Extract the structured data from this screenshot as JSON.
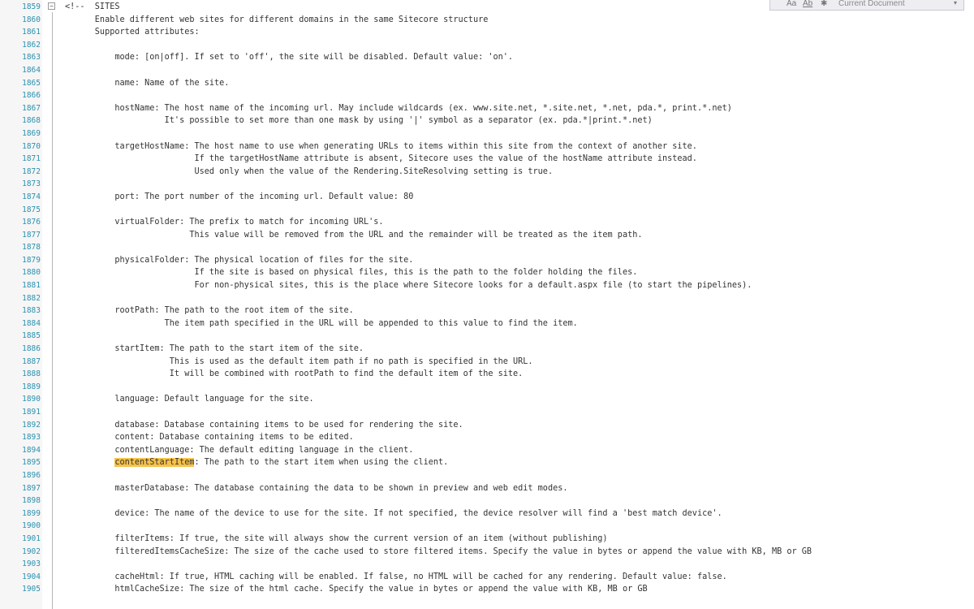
{
  "find": {
    "match_case": "Aa",
    "whole_word": "Ab",
    "regex": "✱",
    "scope": "Current Document",
    "dropdown": "▾"
  },
  "fold_marker": "−",
  "lines": [
    {
      "n": "1859",
      "t": "<!--  SITES"
    },
    {
      "n": "1860",
      "t": "      Enable different web sites for different domains in the same Sitecore structure"
    },
    {
      "n": "1861",
      "t": "      Supported attributes:"
    },
    {
      "n": "1862",
      "t": ""
    },
    {
      "n": "1863",
      "t": "          mode: [on|off]. If set to 'off', the site will be disabled. Default value: 'on'."
    },
    {
      "n": "1864",
      "t": ""
    },
    {
      "n": "1865",
      "t": "          name: Name of the site."
    },
    {
      "n": "1866",
      "t": ""
    },
    {
      "n": "1867",
      "t": "          hostName: The host name of the incoming url. May include wildcards (ex. www.site.net, *.site.net, *.net, pda.*, print.*.net)"
    },
    {
      "n": "1868",
      "t": "                    It's possible to set more than one mask by using '|' symbol as a separator (ex. pda.*|print.*.net)"
    },
    {
      "n": "1869",
      "t": ""
    },
    {
      "n": "1870",
      "t": "          targetHostName: The host name to use when generating URLs to items within this site from the context of another site."
    },
    {
      "n": "1871",
      "t": "                          If the targetHostName attribute is absent, Sitecore uses the value of the hostName attribute instead."
    },
    {
      "n": "1872",
      "t": "                          Used only when the value of the Rendering.SiteResolving setting is true."
    },
    {
      "n": "1873",
      "t": ""
    },
    {
      "n": "1874",
      "t": "          port: The port number of the incoming url. Default value: 80"
    },
    {
      "n": "1875",
      "t": ""
    },
    {
      "n": "1876",
      "t": "          virtualFolder: The prefix to match for incoming URL's."
    },
    {
      "n": "1877",
      "t": "                         This value will be removed from the URL and the remainder will be treated as the item path."
    },
    {
      "n": "1878",
      "t": ""
    },
    {
      "n": "1879",
      "t": "          physicalFolder: The physical location of files for the site."
    },
    {
      "n": "1880",
      "t": "                          If the site is based on physical files, this is the path to the folder holding the files."
    },
    {
      "n": "1881",
      "t": "                          For non-physical sites, this is the place where Sitecore looks for a default.aspx file (to start the pipelines)."
    },
    {
      "n": "1882",
      "t": ""
    },
    {
      "n": "1883",
      "t": "          rootPath: The path to the root item of the site."
    },
    {
      "n": "1884",
      "t": "                    The item path specified in the URL will be appended to this value to find the item."
    },
    {
      "n": "1885",
      "t": ""
    },
    {
      "n": "1886",
      "t": "          startItem: The path to the start item of the site."
    },
    {
      "n": "1887",
      "t": "                     This is used as the default item path if no path is specified in the URL."
    },
    {
      "n": "1888",
      "t": "                     It will be combined with rootPath to find the default item of the site."
    },
    {
      "n": "1889",
      "t": ""
    },
    {
      "n": "1890",
      "t": "          language: Default language for the site."
    },
    {
      "n": "1891",
      "t": ""
    },
    {
      "n": "1892",
      "t": "          database: Database containing items to be used for rendering the site."
    },
    {
      "n": "1893",
      "t": "          content: Database containing items to be edited."
    },
    {
      "n": "1894",
      "t": "          contentLanguage: The default editing language in the client."
    },
    {
      "n": "1895",
      "pre": "          ",
      "hl": "contentStartItem",
      "post": ": The path to the start item when using the client."
    },
    {
      "n": "1896",
      "t": ""
    },
    {
      "n": "1897",
      "t": "          masterDatabase: The database containing the data to be shown in preview and web edit modes."
    },
    {
      "n": "1898",
      "t": ""
    },
    {
      "n": "1899",
      "t": "          device: The name of the device to use for the site. If not specified, the device resolver will find a 'best match device'."
    },
    {
      "n": "1900",
      "t": ""
    },
    {
      "n": "1901",
      "t": "          filterItems: If true, the site will always show the current version of an item (without publishing)"
    },
    {
      "n": "1902",
      "t": "          filteredItemsCacheSize: The size of the cache used to store filtered items. Specify the value in bytes or append the value with KB, MB or GB"
    },
    {
      "n": "1903",
      "t": ""
    },
    {
      "n": "1904",
      "t": "          cacheHtml: If true, HTML caching will be enabled. If false, no HTML will be cached for any rendering. Default value: false."
    },
    {
      "n": "1905",
      "t": "          htmlCacheSize: The size of the html cache. Specify the value in bytes or append the value with KB, MB or GB"
    }
  ]
}
